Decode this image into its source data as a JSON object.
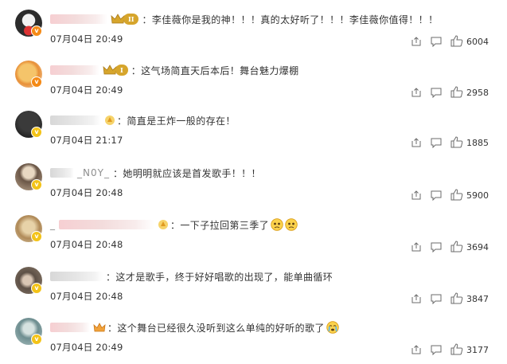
{
  "comments": [
    {
      "name": "",
      "badge": "orange",
      "crown": true,
      "level": "II",
      "text": "：李佳薇你是我的神！！！真的太好听了！！！李佳薇你值得！！！",
      "emoji": [],
      "time": "07月04日 20:49",
      "likes": "6004",
      "avatar_color": "#2c2c2c"
    },
    {
      "name": "",
      "badge": "orange",
      "crown": true,
      "level": "I",
      "text": "：这气场简直天后本后！舞台魅力爆棚",
      "emoji": [],
      "time": "07月04日 20:49",
      "likes": "2958",
      "avatar_color": "#e7b56a"
    },
    {
      "name": "",
      "badge": "yellow",
      "crown": false,
      "level": "",
      "text": "：简直是王炸一般的存在！",
      "emoji": [],
      "time": "07月04日 21:17",
      "likes": "1885",
      "avatar_color": "#1e1e1e"
    },
    {
      "name": "_N0Y_",
      "badge": "yellow",
      "crown": false,
      "level": "",
      "text": "：她明明就应该是首发歌手！！！",
      "emoji": [],
      "time": "07月04日 20:48",
      "likes": "5900",
      "avatar_color": "#b8a28a"
    },
    {
      "name": "_",
      "badge": "yellow",
      "crown": false,
      "level": "",
      "text": "：一下子拉回第三季了",
      "emoji": [
        "sad-face-icon",
        "sad-face-icon"
      ],
      "time": "07月04日 20:48",
      "likes": "3694",
      "avatar_color": "#c3a87a"
    },
    {
      "name": "",
      "badge": "yellow",
      "crown": false,
      "level": "",
      "text": "：这才是歌手，终于好好唱歌的出现了，能单曲循环",
      "emoji": [],
      "time": "07月04日 20:48",
      "likes": "3847",
      "avatar_color": "#5d5046"
    },
    {
      "name": "",
      "badge": "yellow",
      "crown": false,
      "level": "",
      "text": "：这个舞台已经很久没听到这么单纯的好听的歌了",
      "emoji": [
        "crying-face-icon"
      ],
      "time": "07月04日 20:49",
      "likes": "3177",
      "avatar_color": "#8aa7a8"
    }
  ]
}
